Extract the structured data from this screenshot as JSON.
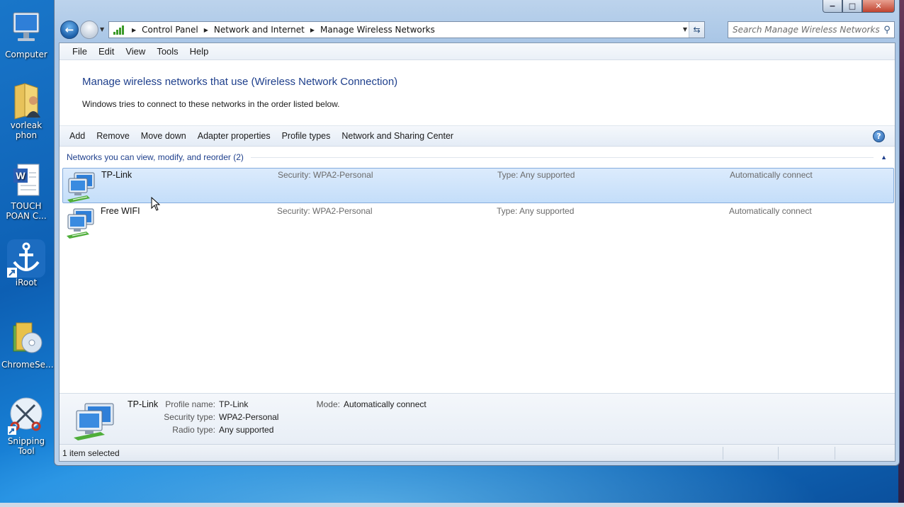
{
  "desktop": {
    "icons": [
      {
        "label": "Computer",
        "icon": "computer-icon"
      },
      {
        "label": "vorleak phon",
        "icon": "user-folder-icon"
      },
      {
        "label": "TOUCH POAN C...",
        "icon": "word-document-icon"
      },
      {
        "label": "iRoot",
        "icon": "anchor-icon"
      },
      {
        "label": "ChromeSe...",
        "icon": "installer-cd-icon"
      },
      {
        "label": "Snipping Tool",
        "icon": "scissors-icon"
      }
    ]
  },
  "window": {
    "controls": {
      "minimize": "−",
      "maximize": "□",
      "close": "✕"
    },
    "address": {
      "crumbs": [
        "Control Panel",
        "Network and Internet",
        "Manage Wireless Networks"
      ]
    },
    "search": {
      "placeholder": "Search Manage Wireless Networks"
    }
  },
  "menu": [
    "File",
    "Edit",
    "View",
    "Tools",
    "Help"
  ],
  "header": {
    "title": "Manage wireless networks that use (Wireless Network Connection)",
    "subtitle": "Windows tries to connect to these networks in the order listed below."
  },
  "toolbar": {
    "items": [
      "Add",
      "Remove",
      "Move down",
      "Adapter properties",
      "Profile types",
      "Network and Sharing Center"
    ]
  },
  "group": {
    "label": "Networks you can view, modify, and reorder (2)"
  },
  "networks": [
    {
      "name": "TP-Link",
      "security": "Security:  WPA2-Personal",
      "type": "Type:  Any supported",
      "mode": "Automatically connect",
      "selected": true
    },
    {
      "name": "Free WIFI",
      "security": "Security:  WPA2-Personal",
      "type": "Type:  Any supported",
      "mode": "Automatically connect",
      "selected": false
    }
  ],
  "details": {
    "name": "TP-Link",
    "profile_name_label": "Profile name:",
    "profile_name": "TP-Link",
    "security_type_label": "Security type:",
    "security_type": "WPA2-Personal",
    "radio_type_label": "Radio type:",
    "radio_type": "Any supported",
    "mode_label": "Mode:",
    "mode": "Automatically connect"
  },
  "status": {
    "text": "1 item selected"
  },
  "colors": {
    "title_blue": "#1e3f8c",
    "selection": "#c4defa",
    "desktop": "#1976c9"
  }
}
